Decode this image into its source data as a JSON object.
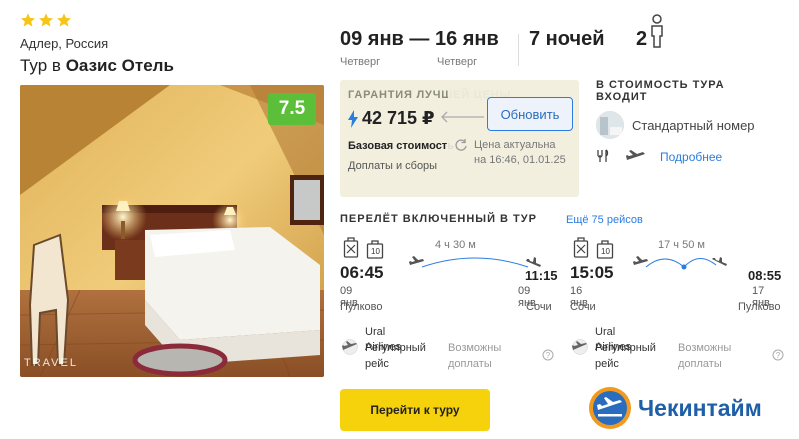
{
  "hotel": {
    "stars": 3,
    "location": "Адлер, Россия",
    "title_prefix": "Тур в",
    "name": "Оазис Отель",
    "rating": "7.5",
    "photo_watermark": "TRAVEL"
  },
  "dates": {
    "range": "09 янв — 16 янв",
    "depart_day": "Четверг",
    "return_day": "Четверг",
    "nights": "7 ночей",
    "guests": "2"
  },
  "price": {
    "guarantee": "ГАРАНТИЯ ЛУЧШЕЙ ЦЕНЫ",
    "amount": "42 715 ₽",
    "base_cost": "Базовая стоимость",
    "fees": "Доплаты и сборы",
    "refresh_label": "Обновить",
    "actual_note": "Цена актуальна",
    "actual_time": "на 16:46, 01.01.25"
  },
  "includes": {
    "title_line1": "В СТОИМОСТЬ ТУРА",
    "title_line2": "ВХОДИТ",
    "room": "Стандартный номер",
    "more": "Подробнее"
  },
  "flights": {
    "title": "ПЕРЕЛЁТ ВКЛЮЧЕННЫЙ В ТУР",
    "more_flights": "Ещё 75 рейсов",
    "outbound": {
      "baggage": "10",
      "duration": "4 ч 30 м",
      "dep_time": "06:45",
      "arr_time": "11:15",
      "dep_date": "09 янв",
      "arr_date": "09 янв",
      "dep_airport": "Пулково",
      "arr_airport": "Сочи",
      "airline": "Ural Airlines",
      "flight_type_1": "Регулярный",
      "flight_type_2": "рейс",
      "extra_1": "Возможны",
      "extra_2": "доплаты"
    },
    "return": {
      "baggage": "10",
      "duration": "17 ч 50 м",
      "dep_time": "15:05",
      "arr_time": "08:55",
      "dep_date": "16 янв",
      "arr_date": "17 янв",
      "dep_airport": "Сочи",
      "arr_airport": "Пулково",
      "airline": "Ural Airlines",
      "flight_type_1": "Регулярный",
      "flight_type_2": "рейс",
      "extra_1": "Возможны",
      "extra_2": "доплаты"
    }
  },
  "actions": {
    "go_to_tour": "Перейти к туру"
  },
  "brand": {
    "name": "Чекинтайм"
  },
  "colors": {
    "accent_blue": "#2a7de1",
    "rating_green": "#5bbf3a",
    "button_yellow": "#f6d20c",
    "star_yellow": "#f5c518",
    "price_bg": "#f2efde"
  }
}
